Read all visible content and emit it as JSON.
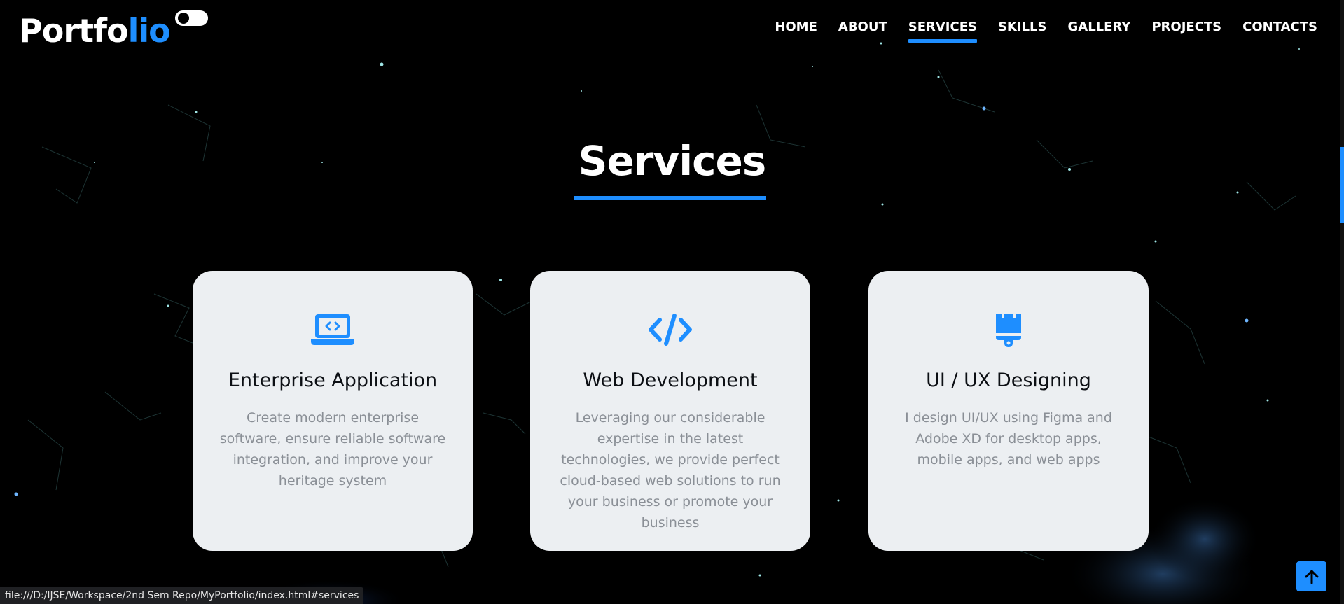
{
  "header": {
    "logo_main": "Portfo",
    "logo_accent": "lio",
    "nav": [
      {
        "label": "HOME"
      },
      {
        "label": "ABOUT"
      },
      {
        "label": "SERVICES"
      },
      {
        "label": "SKILLS"
      },
      {
        "label": "GALLERY"
      },
      {
        "label": "PROJECTS"
      },
      {
        "label": "CONTACTS"
      }
    ],
    "active_nav": "SERVICES"
  },
  "section": {
    "title": "Services"
  },
  "services": [
    {
      "icon": "laptop-code-icon",
      "title": "Enterprise Application",
      "description": "Create modern enterprise software, ensure reliable software integration, and improve your heritage system"
    },
    {
      "icon": "code-icon",
      "title": "Web Development",
      "description": "Leveraging our considerable expertise in the latest technologies, we provide perfect cloud-based web solutions to run your business or promote your business"
    },
    {
      "icon": "paint-brush-icon",
      "title": "UI / UX Designing",
      "description": "I design UI/UX using Figma and Adobe XD for desktop apps, mobile apps, and web apps"
    }
  ],
  "status_bar": {
    "url": "file:///D:/IJSE/Workspace/2nd Sem Repo/MyPortfolio/index.html#services"
  },
  "colors": {
    "accent": "#1e8eff",
    "background": "#000000",
    "card_bg": "#eceff2",
    "card_title": "#0c0f14",
    "card_text": "#8a8f96"
  }
}
